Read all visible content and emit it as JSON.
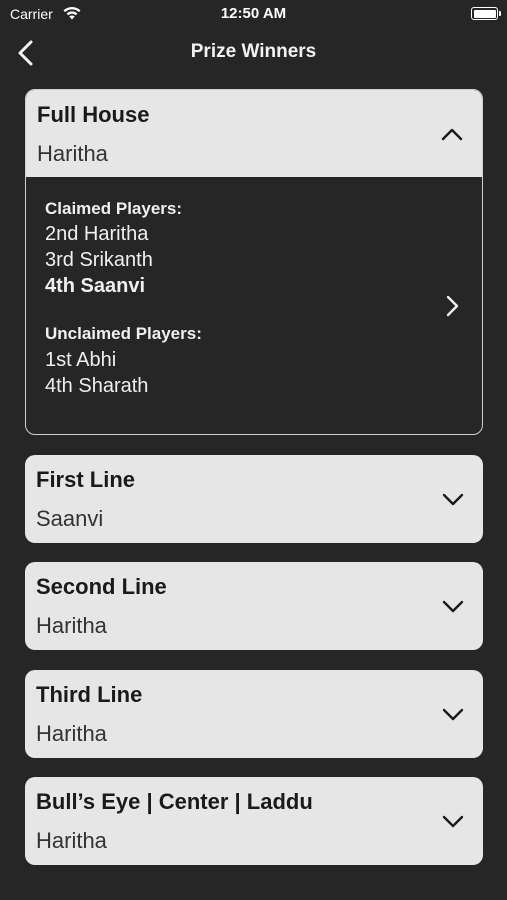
{
  "status": {
    "carrier": "Carrier",
    "time": "12:50 AM"
  },
  "nav": {
    "title": "Prize Winners"
  },
  "prizes": [
    {
      "title": "Full House",
      "winner": "Haritha",
      "expanded": true,
      "claimed_label": "Claimed Players:",
      "claimed": [
        "2nd  Haritha",
        "3rd  Srikanth",
        "4th  Saanvi"
      ],
      "unclaimed_label": "Unclaimed Players:",
      "unclaimed": [
        "1st  Abhi",
        "4th  Sharath"
      ]
    },
    {
      "title": "First Line",
      "winner": "Saanvi",
      "expanded": false
    },
    {
      "title": "Second Line",
      "winner": "Haritha",
      "expanded": false
    },
    {
      "title": "Third Line",
      "winner": "Haritha",
      "expanded": false
    },
    {
      "title": "Bull’s Eye | Center | Laddu",
      "winner": "Haritha",
      "expanded": false
    }
  ],
  "icons": {
    "back": "chevron-left-icon",
    "collapse": "chevron-up-icon",
    "expand": "chevron-down-icon",
    "detail": "chevron-right-icon",
    "wifi": "wifi-icon",
    "battery": "battery-icon"
  }
}
